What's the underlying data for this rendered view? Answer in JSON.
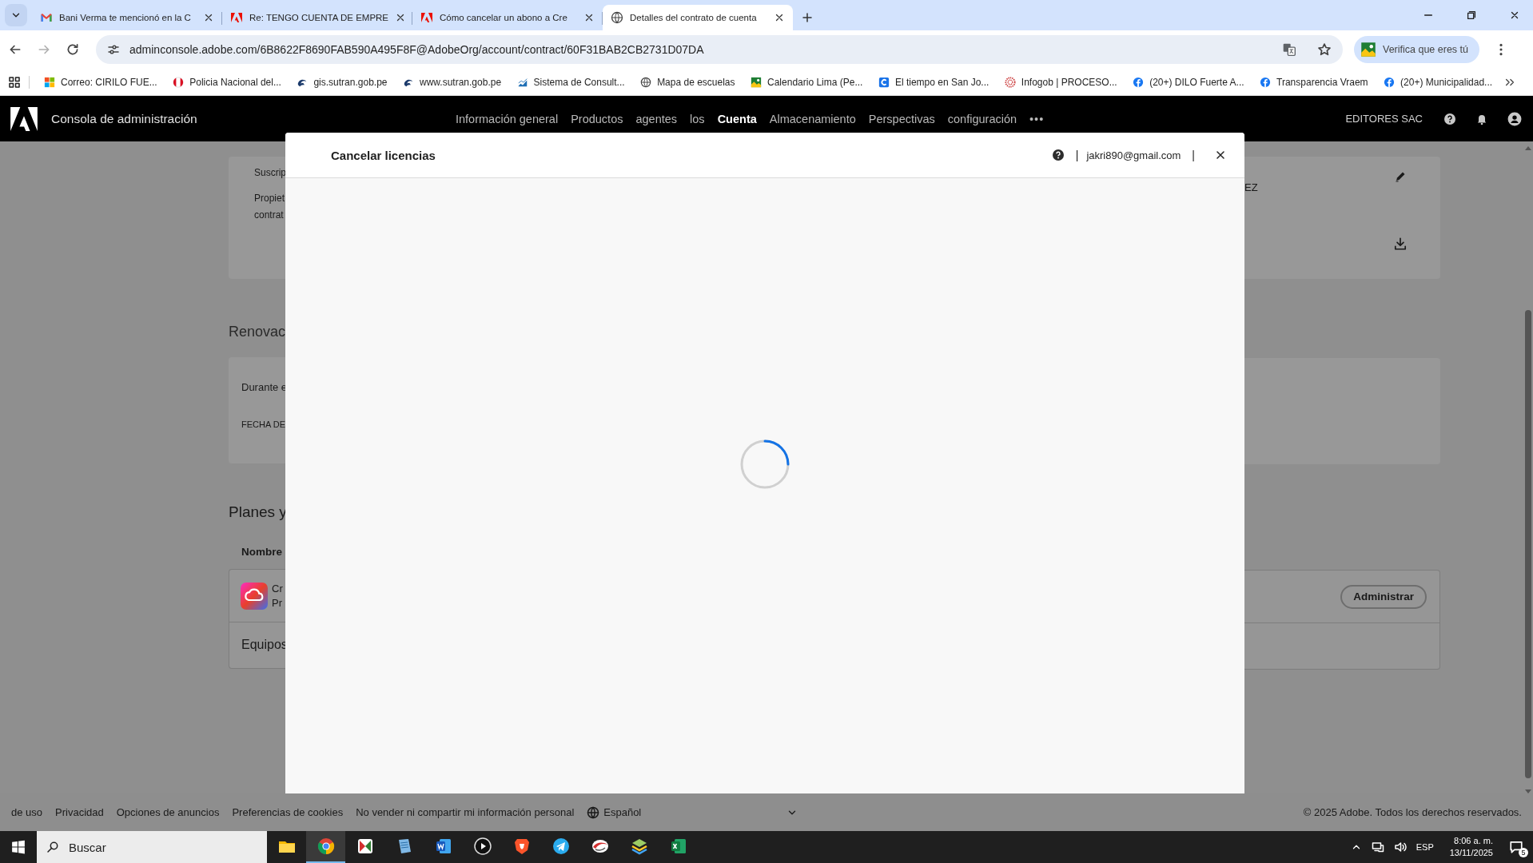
{
  "browser": {
    "tabs": [
      {
        "title": "Bani Verma te mencionó en la C",
        "kind": "mail",
        "selected": false
      },
      {
        "title": "Re: TENGO CUENTA DE EMPRE",
        "kind": "triangle",
        "selected": false
      },
      {
        "title": "Cómo cancelar un abono a Cre",
        "kind": "triangle",
        "selected": false
      },
      {
        "title": "Detalles del contrato de cuenta",
        "kind": "globe",
        "selected": true
      }
    ],
    "url": "adminconsole.adobe.com/6B8622F8690FAB590A495F8F@AdobeOrg/account/contract/60F31BAB2CB2731D07DA",
    "profile_button": "Verifica que eres tú",
    "bookmarks": [
      {
        "label": "Correo: CIRILO FUE...",
        "kind": "squares"
      },
      {
        "label": "Policia Nacional del...",
        "kind": "flag"
      },
      {
        "label": "gis.sutran.gob.pe",
        "kind": "swirl"
      },
      {
        "label": "www.sutran.gob.pe",
        "kind": "swirl"
      },
      {
        "label": "Sistema de Consult...",
        "kind": "bars"
      },
      {
        "label": "Mapa de escuelas",
        "kind": "globe"
      },
      {
        "label": "Calendario Lima (Pe...",
        "kind": "landscape"
      },
      {
        "label": "El tiempo en San Jo...",
        "kind": "tile"
      },
      {
        "label": "Infogob | PROCESO...",
        "kind": "dots"
      },
      {
        "label": "(20+) DILO Fuerte A...",
        "kind": "round"
      },
      {
        "label": "Transparencia Vraem",
        "kind": "round"
      },
      {
        "label": "(20+) Municipalidad...",
        "kind": "round"
      }
    ]
  },
  "header": {
    "title": "Consola de administración",
    "nav": [
      {
        "label": "Información general",
        "selected": false
      },
      {
        "label": "Productos",
        "selected": false
      },
      {
        "label": "agentes",
        "selected": false
      },
      {
        "label": "los",
        "selected": false
      },
      {
        "label": "Cuenta",
        "selected": true
      },
      {
        "label": "Almacenamiento",
        "selected": false
      },
      {
        "label": "Perspectivas",
        "selected": false
      },
      {
        "label": "configuración",
        "selected": false
      }
    ],
    "more": "•••",
    "organization": "EDITORES SAC"
  },
  "page": {
    "contract_lines": [
      "Suscrip",
      "Propiet",
      "contrat"
    ],
    "owner_tail": "EZ",
    "renewal_heading": "Renovac",
    "renewal_lines": [
      "Durante e",
      "FECHA DE"
    ],
    "plans_heading": "Planes y",
    "column": "Nombre",
    "product_lines": [
      "Cr",
      "Pr"
    ],
    "manage_button": "Administrar",
    "teams_row": "Equipos"
  },
  "modal": {
    "title": "Cancelar licencias",
    "separator_before": "|",
    "account": "jakri890@gmail.com",
    "separator_after": "|",
    "loading": true
  },
  "footer": {
    "links": [
      "de uso",
      "Privacidad",
      "Opciones de anuncios",
      "Preferencias de cookies",
      "No vender ni compartir mi información personal"
    ],
    "language": "Español",
    "copyright": "© 2025 Adobe. Todos los derechos reservados."
  },
  "taskbar": {
    "search_placeholder": "Buscar",
    "apps": [
      {
        "kind": "folder",
        "selected": false
      },
      {
        "kind": "ring",
        "selected": true
      },
      {
        "kind": "tiles",
        "selected": false
      },
      {
        "kind": "notebook",
        "selected": false
      },
      {
        "kind": "document",
        "selected": false
      },
      {
        "kind": "play",
        "selected": false
      },
      {
        "kind": "shield",
        "selected": false
      },
      {
        "kind": "plane",
        "selected": false
      },
      {
        "kind": "swoosh",
        "selected": false
      },
      {
        "kind": "layers",
        "selected": false
      },
      {
        "kind": "sheet",
        "selected": false
      }
    ],
    "language": "ESP",
    "time": "8:06 a. m.",
    "date": "13/11/2025",
    "notifications": "5"
  }
}
